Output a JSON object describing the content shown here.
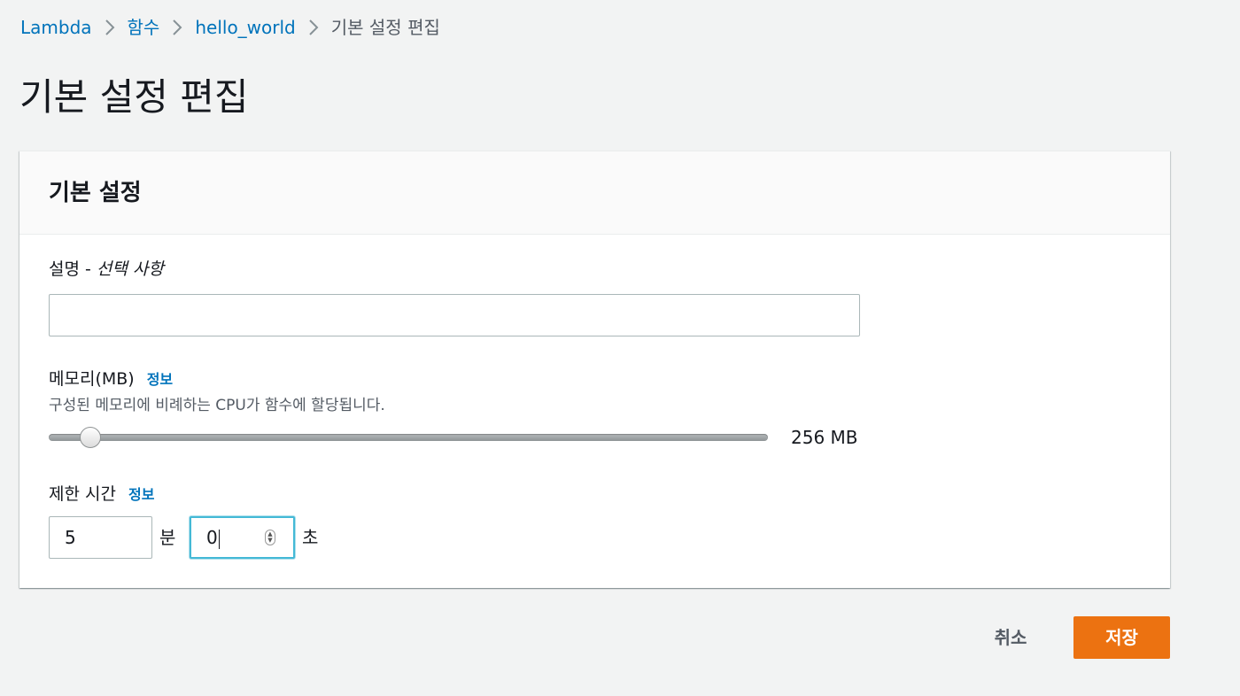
{
  "breadcrumb": {
    "items": [
      "Lambda",
      "함수",
      "hello_world",
      "기본 설정 편집"
    ]
  },
  "page": {
    "title": "기본 설정 편집"
  },
  "panel": {
    "title": "기본 설정",
    "description": {
      "label": "설명 - ",
      "optional": "선택 사항",
      "value": "",
      "placeholder": ""
    },
    "memory": {
      "label": "메모리(MB)",
      "info": "정보",
      "hint": "구성된 메모리에 비례하는 CPU가 함수에 할당됩니다.",
      "value_text": "256 MB",
      "value_mb": 256
    },
    "timeout": {
      "label": "제한 시간",
      "info": "정보",
      "minutes": "5",
      "minutes_unit": "분",
      "seconds": "0",
      "seconds_unit": "초"
    }
  },
  "actions": {
    "cancel": "취소",
    "save": "저장"
  },
  "colors": {
    "link": "#0073bb",
    "primary": "#ec7211",
    "focus": "#44b9d6"
  }
}
